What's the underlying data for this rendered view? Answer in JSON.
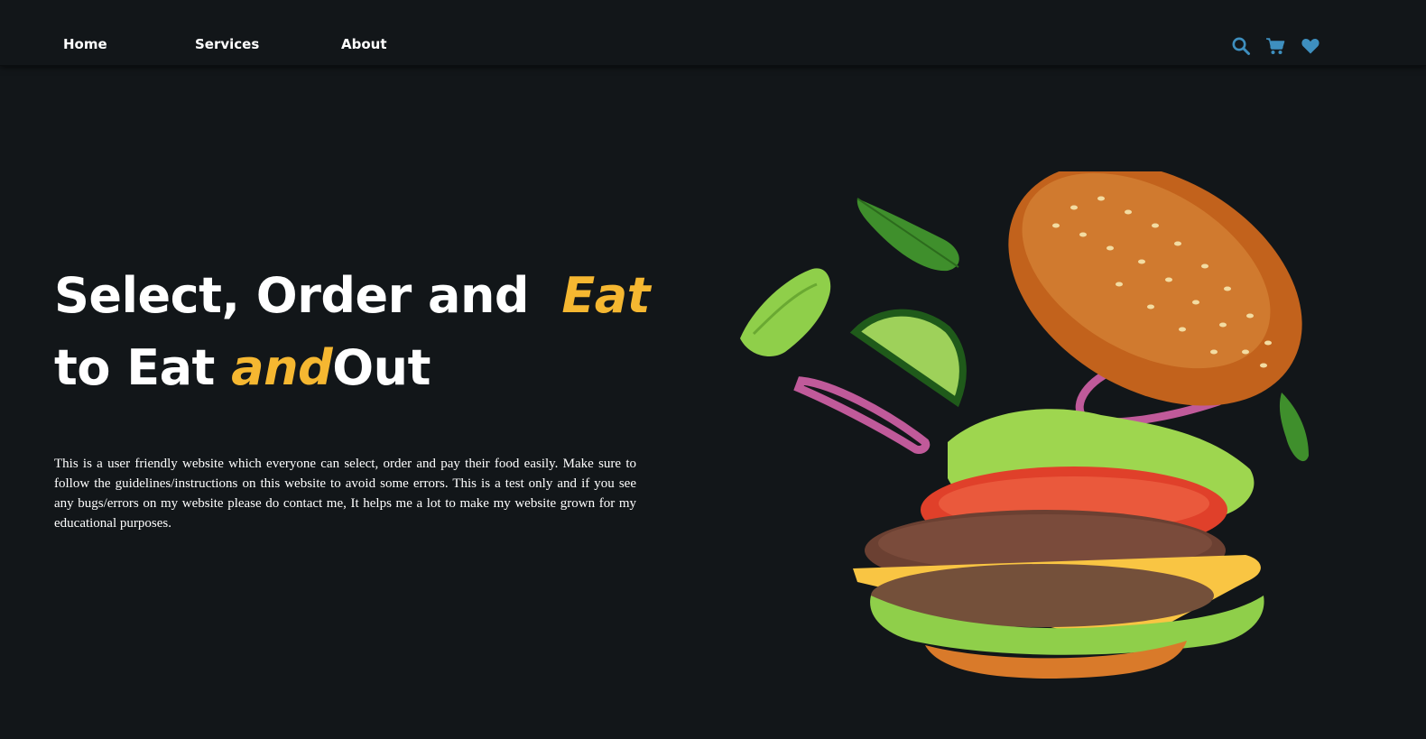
{
  "nav": {
    "links": [
      {
        "label": "Home"
      },
      {
        "label": "Services"
      },
      {
        "label": "About"
      }
    ],
    "icons": [
      "search-icon",
      "cart-icon",
      "heart-icon"
    ],
    "icon_color": "#3e8fbf"
  },
  "hero": {
    "title_line1_part1": "Select, Order and",
    "title_line1_accent": "Eat",
    "title_line2_part1": "to Eat",
    "title_line2_accent": "and",
    "title_line2_part2": "Out",
    "description": "This is a user friendly website which everyone can select, order and pay their food easily. Make sure to follow the guidelines/instructions on this website to avoid some errors. This is a test only and if you see any bugs/errors on my website please do contact me, It helps me a lot to make my website grown for my educational purposes."
  },
  "colors": {
    "background": "#121619",
    "accent": "#f5b731",
    "text": "#ffffff"
  }
}
